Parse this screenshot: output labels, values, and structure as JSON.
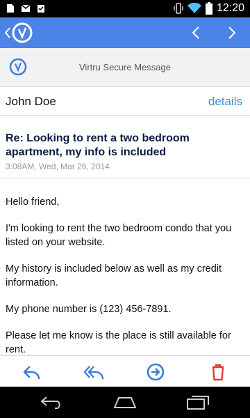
{
  "status_bar": {
    "time": "12:20",
    "left_icons": [
      "sim-icon",
      "gmail-icon",
      "clipboard-check-icon"
    ],
    "right_icons": [
      "vibrate-icon",
      "wifi-icon",
      "battery-icon"
    ]
  },
  "app_bar": {
    "logo_icon": "virtru-logo-icon",
    "prev_icon": "chevron-left-icon",
    "next_icon": "chevron-right-icon",
    "color": "#4c83e6"
  },
  "banner": {
    "title": "Virtru Secure Message"
  },
  "message": {
    "sender": "John Doe",
    "details_label": "details",
    "subject": "Re: Looking to rent a two bedroom apartment, my info is included",
    "date": "3:08AM, Wed, Mar 26, 2014",
    "paragraphs": [
      "Hello friend,",
      "I'm looking to rent the two bedroom condo that you listed on your website.",
      "My history is included below as well as my credit information.",
      "My phone number is (123) 456-7891.",
      "Please let me know is the place is still available for rent."
    ]
  },
  "actions": {
    "reply_icon": "reply-icon",
    "reply_all_icon": "reply-all-icon",
    "forward_icon": "forward-icon",
    "delete_icon": "trash-icon",
    "accent": "#3b7ed9",
    "delete_color": "#e53935"
  },
  "nav_bar": {
    "back_icon": "back-icon",
    "home_icon": "home-icon",
    "recents_icon": "recents-icon"
  }
}
